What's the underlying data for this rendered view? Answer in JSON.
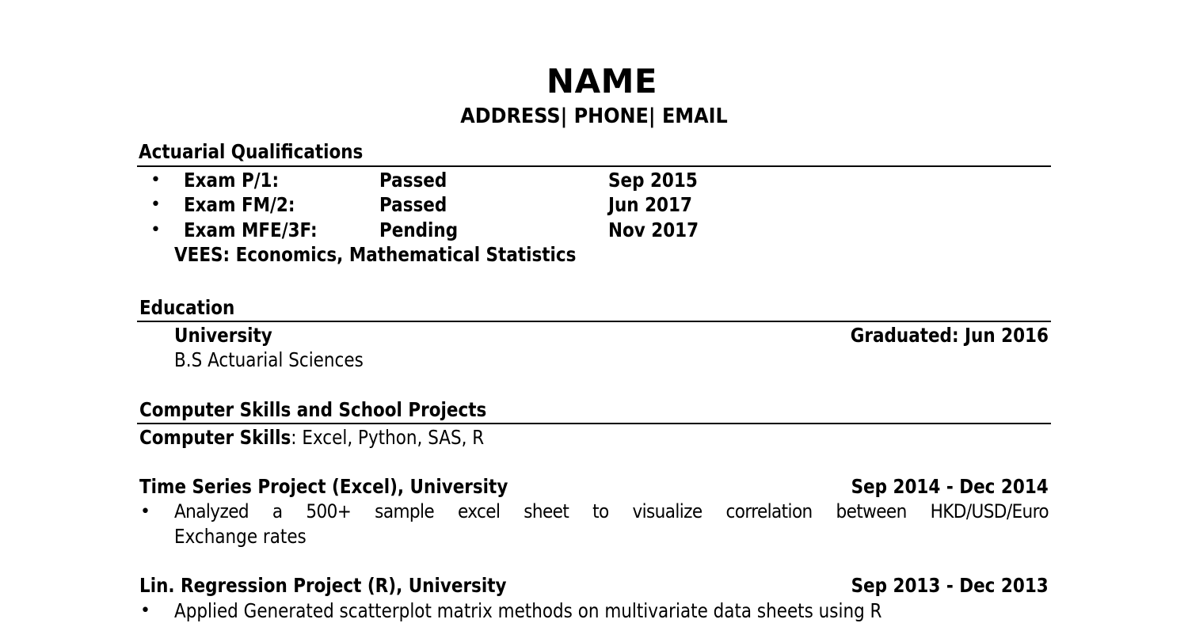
{
  "header": {
    "name": "NAME",
    "contact": "ADDRESS| PHONE| EMAIL"
  },
  "qualifications": {
    "heading": "Actuarial Qualifications",
    "bullet": "•",
    "exams": [
      {
        "exam": "Exam P/1:",
        "status": "Passed",
        "date": "Sep 2015"
      },
      {
        "exam": "Exam FM/2:",
        "status": "Passed",
        "date": "Jun 2017"
      },
      {
        "exam": "Exam MFE/3F:",
        "status": "Pending",
        "date": "Nov 2017"
      }
    ],
    "vees": "VEES: Economics, Mathematical Statistics"
  },
  "education": {
    "heading": "Education",
    "school": "University",
    "graduated": "Graduated: Jun 2016",
    "degree": "B.S Actuarial Sciences"
  },
  "skills": {
    "heading": "Computer Skills and School Projects",
    "label": "Computer Skills",
    "value": ": Excel, Python, SAS, R"
  },
  "projects": [
    {
      "title": "Time Series Project (Excel), University",
      "dates": "Sep 2014 - Dec 2014",
      "bullets": [
        {
          "line1": "Analyzed a 500+ sample excel sheet to visualize correlation between HKD/USD/Euro",
          "line2": "Exchange rates"
        }
      ]
    },
    {
      "title": "Lin. Regression Project (R), University",
      "dates": "Sep 2013 - Dec 2013",
      "bullets": [
        {
          "line1": "Applied Generated scatterplot matrix methods on multivariate data sheets using R"
        }
      ]
    }
  ]
}
